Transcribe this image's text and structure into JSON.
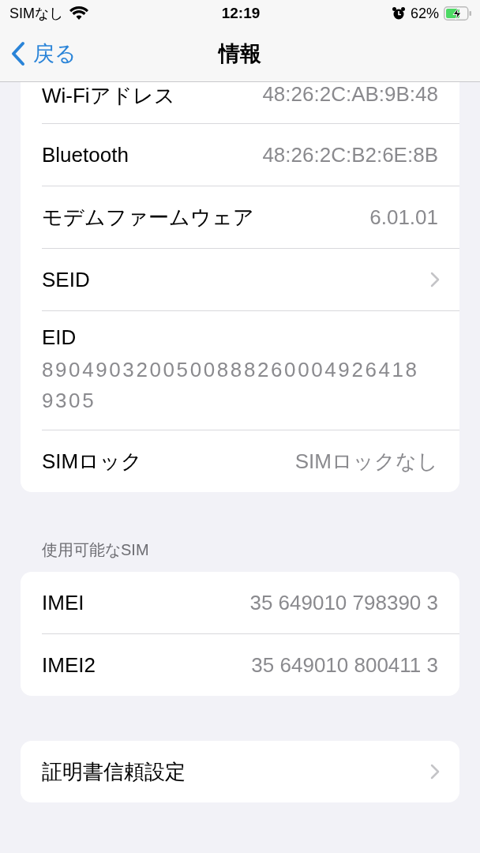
{
  "status_bar": {
    "carrier": "SIMなし",
    "time": "12:19",
    "battery_percent": "62%"
  },
  "nav": {
    "back": "戻る",
    "title": "情報"
  },
  "groups": [
    {
      "rows": [
        {
          "kind": "value",
          "label": "Wi-Fiアドレス",
          "value": "48:26:2C:AB:9B:48"
        },
        {
          "kind": "value",
          "label": "Bluetooth",
          "value": "48:26:2C:B2:6E:8B"
        },
        {
          "kind": "value",
          "label": "モデムファームウェア",
          "value": "6.01.01"
        },
        {
          "kind": "link",
          "label": "SEID"
        },
        {
          "kind": "stacked",
          "label": "EID",
          "value": "89049032005008882600049264189305"
        },
        {
          "kind": "value",
          "label": "SIMロック",
          "value": "SIMロックなし"
        }
      ]
    },
    {
      "header": "使用可能なSIM",
      "rows": [
        {
          "kind": "value",
          "label": "IMEI",
          "value": "35 649010 798390 3"
        },
        {
          "kind": "value",
          "label": "IMEI2",
          "value": "35 649010 800411 3"
        }
      ]
    },
    {
      "rows": [
        {
          "kind": "link",
          "label": "証明書信頼設定"
        }
      ]
    }
  ]
}
